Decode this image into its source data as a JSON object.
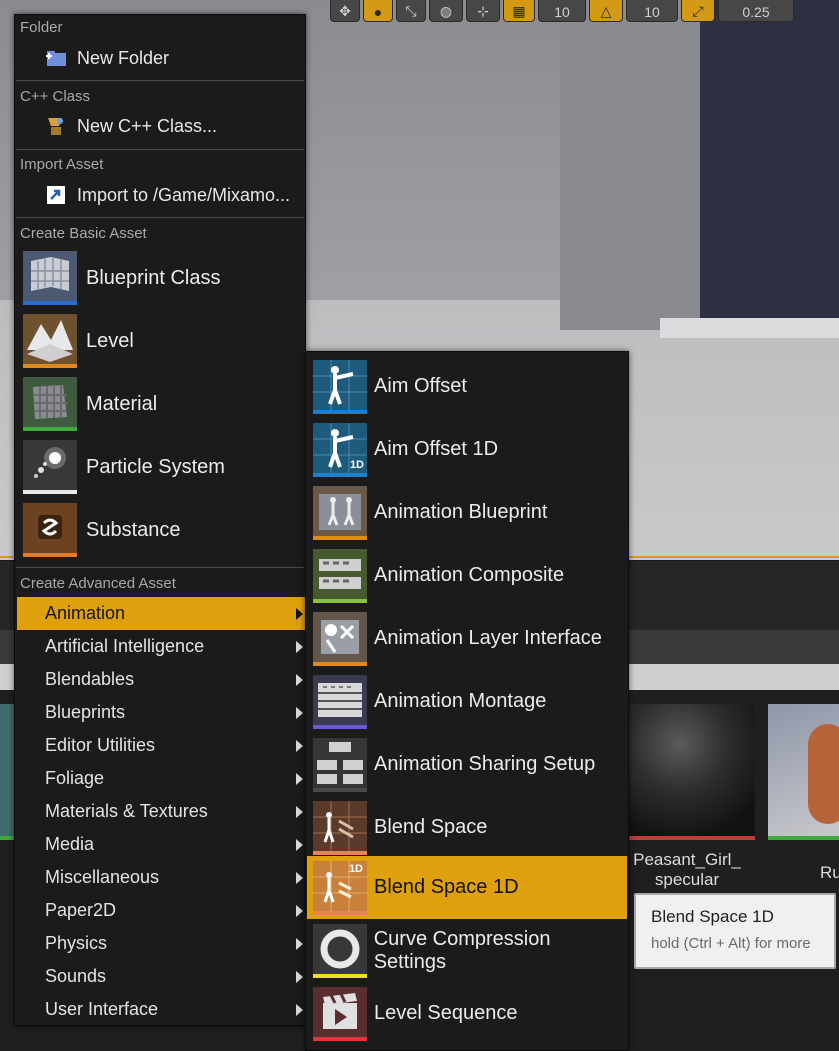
{
  "viewport_toolbar": {
    "grid_snap_value": "10",
    "rotation_snap_value": "10",
    "scale_snap_value": "0.25"
  },
  "colors": {
    "highlight": "#dfa00e",
    "menu_bg": "#1b1b1b",
    "blueprint": "#2a6fd0",
    "level": "#e08a1e",
    "material": "#3cab3c",
    "particle": "#e8e8e8",
    "substance": "#e8781e",
    "animation": "#1e7fd0"
  },
  "menu": {
    "folder_section": {
      "header": "Folder",
      "item": "New Folder"
    },
    "cpp_section": {
      "header": "C++ Class",
      "item": "New C++ Class..."
    },
    "import_section": {
      "header": "Import Asset",
      "item": "Import to /Game/Mixamo..."
    },
    "basic_section": {
      "header": "Create Basic Asset",
      "items": [
        "Blueprint Class",
        "Level",
        "Material",
        "Particle System",
        "Substance"
      ]
    },
    "advanced_section": {
      "header": "Create Advanced Asset",
      "items": [
        "Animation",
        "Artificial Intelligence",
        "Blendables",
        "Blueprints",
        "Editor Utilities",
        "Foliage",
        "Materials & Textures",
        "Media",
        "Miscellaneous",
        "Paper2D",
        "Physics",
        "Sounds",
        "User Interface"
      ]
    }
  },
  "submenu": {
    "items": [
      "Aim Offset",
      "Aim Offset 1D",
      "Animation Blueprint",
      "Animation Composite",
      "Animation Layer Interface",
      "Animation Montage",
      "Animation Sharing Setup",
      "Blend Space",
      "Blend Space 1D",
      "Curve Compression Settings",
      "Level Sequence"
    ],
    "badge_1d": "1D"
  },
  "content_browser": {
    "asset_label_line1": "Peasant_Girl_",
    "asset_label_line2": "specular",
    "asset_label_partial": "Ru"
  },
  "tooltip": {
    "title": "Blend Space 1D",
    "hint": "hold (Ctrl + Alt) for more"
  }
}
